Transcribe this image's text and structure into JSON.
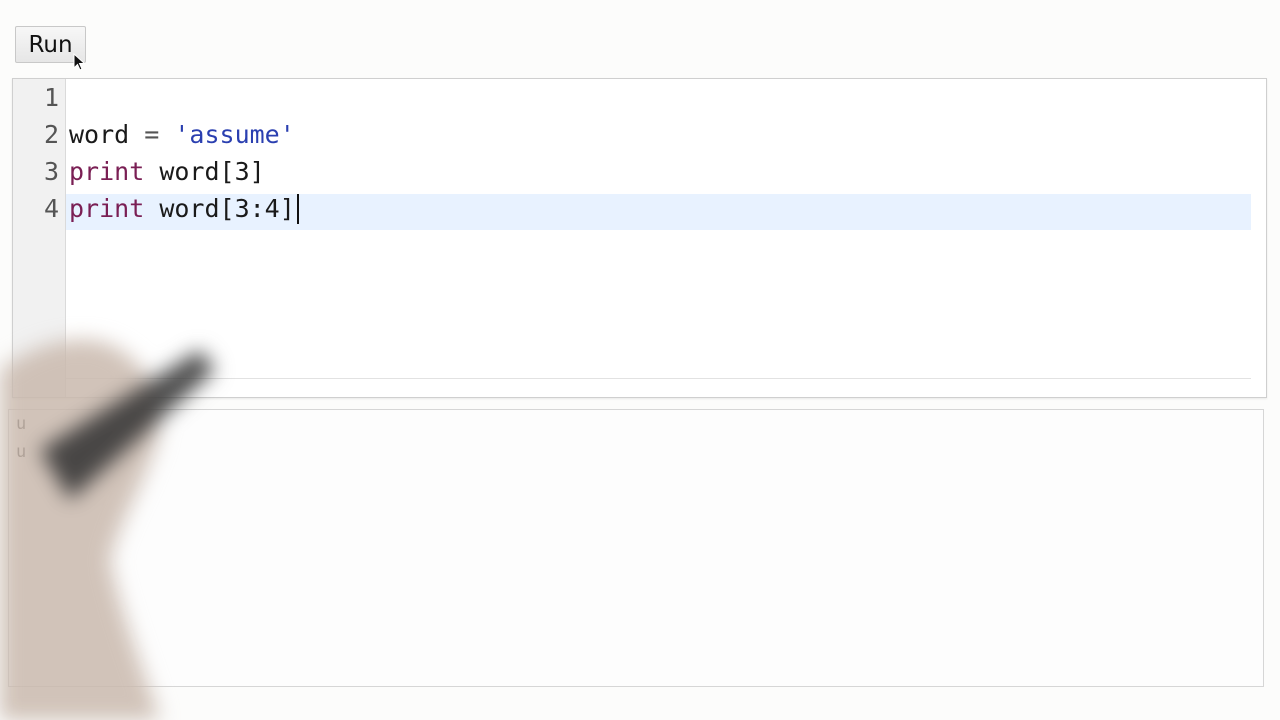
{
  "toolbar": {
    "run_label": "Run"
  },
  "editor": {
    "language": "python",
    "active_line": 4,
    "lines": [
      {
        "number": "1",
        "tokens": []
      },
      {
        "number": "2",
        "tokens": [
          {
            "text": "word",
            "kind": "plain"
          },
          {
            "text": " = ",
            "kind": "op"
          },
          {
            "text": "'assume'",
            "kind": "str"
          }
        ]
      },
      {
        "number": "3",
        "tokens": [
          {
            "text": "print",
            "kind": "kw"
          },
          {
            "text": " word[3]",
            "kind": "plain"
          }
        ]
      },
      {
        "number": "4",
        "tokens": [
          {
            "text": "print",
            "kind": "kw"
          },
          {
            "text": " word[3:4]",
            "kind": "plain"
          }
        ]
      }
    ]
  },
  "output": {
    "lines": [
      "u",
      "u"
    ]
  },
  "colors": {
    "keyword": "#7a1f54",
    "string": "#2a3fb0",
    "active_line_bg": "#e8f2ff",
    "gutter_bg": "#f1f1f1"
  }
}
